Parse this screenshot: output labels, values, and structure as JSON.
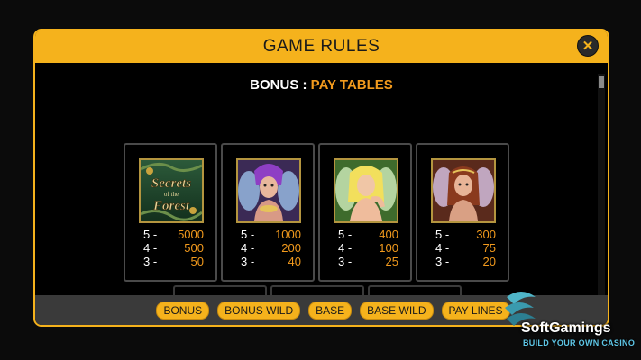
{
  "modal": {
    "title": "GAME RULES",
    "close_label": "✕"
  },
  "subtitle": {
    "prefix": "BONUS : ",
    "highlight": "PAY TABLES"
  },
  "colors": {
    "accent": "#f5b21c",
    "value": "#f29a1d",
    "background": "#000000"
  },
  "symbols": [
    {
      "name": "Secrets of the Forest logo",
      "logo_text": "Secrets of the Forest",
      "pays": [
        {
          "count": "5 -",
          "value": "5000"
        },
        {
          "count": "4 -",
          "value": "500"
        },
        {
          "count": "3 -",
          "value": "50"
        }
      ]
    },
    {
      "name": "purple-haired fairy",
      "pays": [
        {
          "count": "5 -",
          "value": "1000"
        },
        {
          "count": "4 -",
          "value": "200"
        },
        {
          "count": "3 -",
          "value": "40"
        }
      ]
    },
    {
      "name": "blonde fairy",
      "pays": [
        {
          "count": "5 -",
          "value": "400"
        },
        {
          "count": "4 -",
          "value": "100"
        },
        {
          "count": "3 -",
          "value": "25"
        }
      ]
    },
    {
      "name": "red-haired fairy",
      "pays": [
        {
          "count": "5 -",
          "value": "300"
        },
        {
          "count": "4 -",
          "value": "75"
        },
        {
          "count": "3 -",
          "value": "20"
        }
      ]
    }
  ],
  "tabs": [
    "BONUS",
    "BONUS WILD",
    "BASE",
    "BASE WILD",
    "PAY LINES"
  ],
  "brand": {
    "name": "SoftGamings",
    "tagline": "BUILD YOUR OWN CASINO"
  }
}
